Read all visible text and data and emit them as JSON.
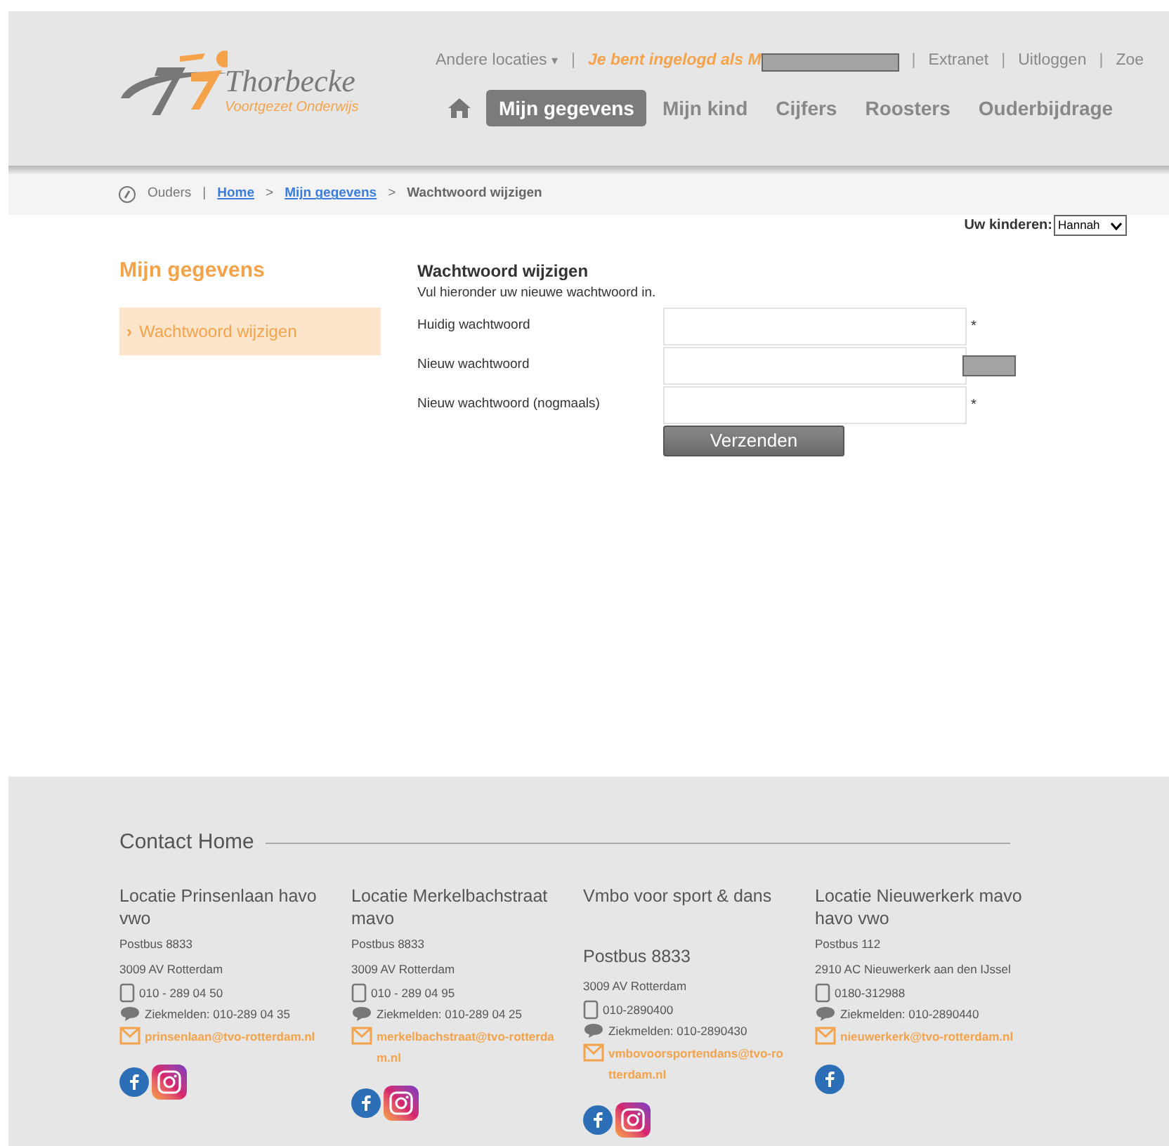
{
  "logo": {
    "name": "Thorbecke",
    "tagline": "Voortgezet Onderwijs"
  },
  "top_links": [
    {
      "kind": "dropdown",
      "label": "Andere locaties",
      "caret": "▾"
    },
    {
      "kind": "login",
      "label": "Je bent ingelogd als M"
    },
    {
      "kind": "link",
      "label": "Extranet"
    },
    {
      "kind": "link",
      "label": "Uitloggen"
    },
    {
      "kind": "link",
      "label": "Zoe"
    }
  ],
  "top_link_separators": [
    "|",
    "|",
    "|",
    "|"
  ],
  "nav": [
    {
      "kind": "home",
      "selected": false
    },
    {
      "kind": "tab",
      "label": "Mijn gegevens",
      "selected": true
    },
    {
      "kind": "tab",
      "label": "Mijn kind",
      "selected": false
    },
    {
      "kind": "tab",
      "label": "Cijfers",
      "selected": false
    },
    {
      "kind": "tab",
      "label": "Roosters",
      "selected": false
    },
    {
      "kind": "tab",
      "label": "Ouderbijdrage",
      "selected": false
    }
  ],
  "breadcrumb": [
    {
      "kind": "text",
      "label": "Ouders"
    },
    {
      "kind": "link",
      "label": "Home"
    },
    {
      "kind": "link",
      "label": "Mijn gegevens"
    },
    {
      "kind": "current",
      "label": "Wachtwoord wijzigen"
    }
  ],
  "breadcrumb_separators": [
    "|",
    ">",
    ">"
  ],
  "children_select": {
    "label": "Uw kinderen:",
    "value": "Hannah"
  },
  "sidebar": {
    "title": "Mijn gegevens",
    "items": [
      {
        "marker": "›",
        "label": "Wachtwoord wijzigen",
        "selected": true
      }
    ]
  },
  "form": {
    "title": "Wachtwoord wijzigen",
    "intro": "Vul hieronder uw nieuwe wachtwoord in.",
    "fields": [
      {
        "label": "Huidig wachtwoord",
        "kind": "asterisk",
        "mark": "*"
      },
      {
        "label": "Nieuw wachtwoord",
        "kind": "redacted"
      },
      {
        "label": "Nieuw wachtwoord (nogmaals)",
        "kind": "asterisk",
        "mark": "*"
      }
    ],
    "submit": "Verzenden"
  },
  "footer": {
    "title": "Contact Home",
    "locations": [
      {
        "title": "Locatie Prinsenlaan havo vwo",
        "postbus": "Postbus 8833",
        "postbus_large": false,
        "city": "3009 AV Rotterdam",
        "phone": "010 - 289 04 50",
        "sick": "Ziekmelden: 010-289 04 35",
        "email": "prinsenlaan@tvo-rotterdam.nl",
        "facebook": true,
        "instagram": true
      },
      {
        "title": "Locatie Merkelbachstraat mavo",
        "postbus": "Postbus 8833",
        "postbus_large": false,
        "city": "3009 AV Rotterdam",
        "phone": "010 - 289 04 95",
        "sick": "Ziekmelden: 010-289 04 25",
        "email": "merkelbachstraat@tvo-rotterdam.nl",
        "facebook": true,
        "instagram": true
      },
      {
        "title": "Vmbo voor sport & dans",
        "postbus": "Postbus 8833",
        "postbus_large": true,
        "city": "3009 AV Rotterdam",
        "phone": "010-2890400",
        "sick": "Ziekmelden: 010-2890430",
        "email": "vmbovoorsportendans@tvo-rotterdam.nl",
        "facebook": true,
        "instagram": true
      },
      {
        "title": "Locatie Nieuwerkerk mavo havo vwo",
        "postbus": "Postbus 112",
        "postbus_large": false,
        "city": "2910 AC Nieuwerkerk aan den IJssel",
        "phone": "0180-312988",
        "sick": "Ziekmelden: 010-2890440",
        "email": "nieuwerkerk@tvo-rotterdam.nl",
        "facebook": true,
        "instagram": false
      }
    ]
  }
}
